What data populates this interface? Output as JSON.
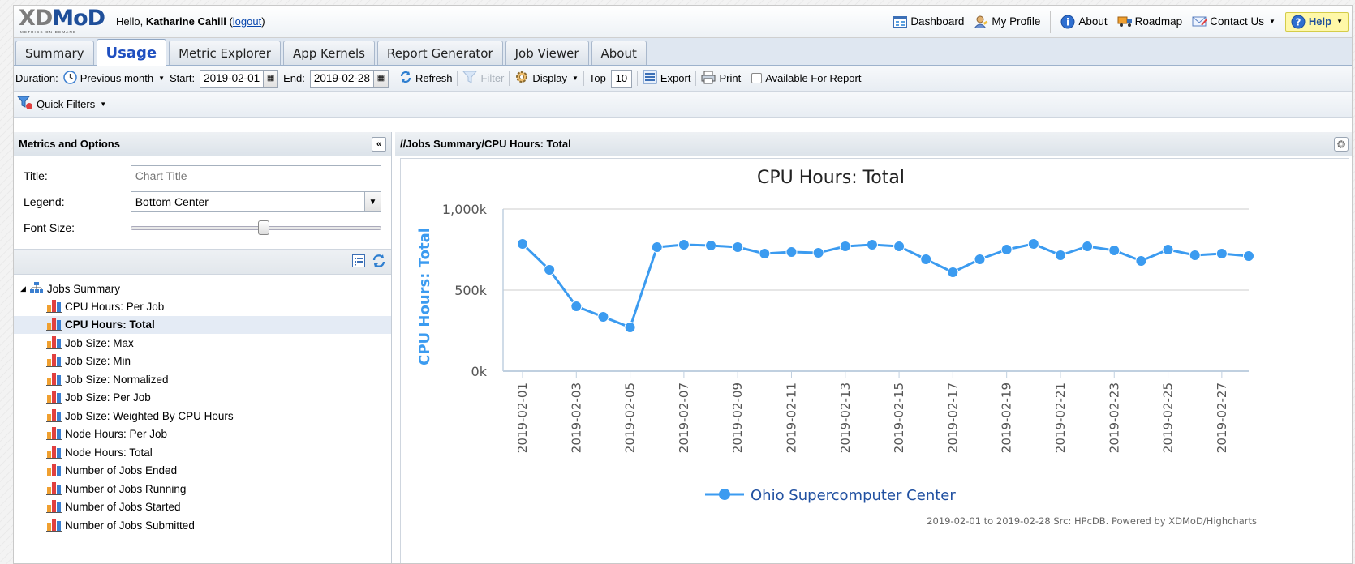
{
  "header": {
    "logo_text": "XDMoD",
    "logo_tagline": "METRICS ON DEMAND",
    "greeting": "Hello,",
    "user": "Katharine Cahill",
    "logout": "logout",
    "links": [
      "Dashboard",
      "My Profile",
      "About",
      "Roadmap",
      "Contact Us"
    ],
    "help": "Help"
  },
  "tabs": [
    "Summary",
    "Usage",
    "Metric Explorer",
    "App Kernels",
    "Report Generator",
    "Job Viewer",
    "About"
  ],
  "active_tab": "Usage",
  "toolbar": {
    "duration_label": "Duration:",
    "duration_value": "Previous month",
    "start_label": "Start:",
    "start_value": "2019-02-01",
    "end_label": "End:",
    "end_value": "2019-02-28",
    "refresh": "Refresh",
    "filter": "Filter",
    "display": "Display",
    "top_label": "Top",
    "top_value": "10",
    "export": "Export",
    "print": "Print",
    "available": "Available For Report"
  },
  "quick_filters": "Quick Filters",
  "left_panel": {
    "title": "Metrics and Options",
    "title_label": "Title:",
    "title_placeholder": "Chart Title",
    "legend_label": "Legend:",
    "legend_value": "Bottom Center",
    "font_size_label": "Font Size:",
    "font_size_fraction": 0.53,
    "tree_root": "Jobs Summary",
    "tree_items": [
      "CPU Hours: Per Job",
      "CPU Hours: Total",
      "Job Size: Max",
      "Job Size: Min",
      "Job Size: Normalized",
      "Job Size: Per Job",
      "Job Size: Weighted By CPU Hours",
      "Node Hours: Per Job",
      "Node Hours: Total",
      "Number of Jobs Ended",
      "Number of Jobs Running",
      "Number of Jobs Started",
      "Number of Jobs Submitted"
    ],
    "selected_item": "CPU Hours: Total"
  },
  "right_panel": {
    "path": "//Jobs Summary/CPU Hours: Total"
  },
  "chart_data": {
    "type": "line",
    "title": "CPU Hours: Total",
    "ylabel": "CPU Hours: Total",
    "xlabel": "",
    "ylim": [
      0,
      1000000
    ],
    "yticks": [
      0,
      500000,
      1000000
    ],
    "ytick_labels": [
      "0k",
      "500k",
      "1,000k"
    ],
    "x": [
      "2019-02-01",
      "2019-02-02",
      "2019-02-03",
      "2019-02-04",
      "2019-02-05",
      "2019-02-06",
      "2019-02-07",
      "2019-02-08",
      "2019-02-09",
      "2019-02-10",
      "2019-02-11",
      "2019-02-12",
      "2019-02-13",
      "2019-02-14",
      "2019-02-15",
      "2019-02-16",
      "2019-02-17",
      "2019-02-18",
      "2019-02-19",
      "2019-02-20",
      "2019-02-21",
      "2019-02-22",
      "2019-02-23",
      "2019-02-24",
      "2019-02-25",
      "2019-02-26",
      "2019-02-27",
      "2019-02-28"
    ],
    "xtick_labels": [
      "2019-02-01",
      "2019-02-03",
      "2019-02-05",
      "2019-02-07",
      "2019-02-09",
      "2019-02-11",
      "2019-02-13",
      "2019-02-15",
      "2019-02-17",
      "2019-02-19",
      "2019-02-21",
      "2019-02-23",
      "2019-02-25",
      "2019-02-27"
    ],
    "series": [
      {
        "name": "Ohio Supercomputer Center",
        "color": "#3b9bf0",
        "values": [
          785000,
          625000,
          400000,
          335000,
          270000,
          765000,
          780000,
          775000,
          765000,
          725000,
          735000,
          730000,
          770000,
          780000,
          770000,
          690000,
          610000,
          690000,
          750000,
          785000,
          715000,
          770000,
          745000,
          680000,
          750000,
          715000,
          725000,
          710000
        ]
      }
    ],
    "grid": true,
    "legend": "bottom-center",
    "credits": "2019-02-01 to 2019-02-28 Src: HPcDB. Powered by XDMoD/Highcharts"
  }
}
